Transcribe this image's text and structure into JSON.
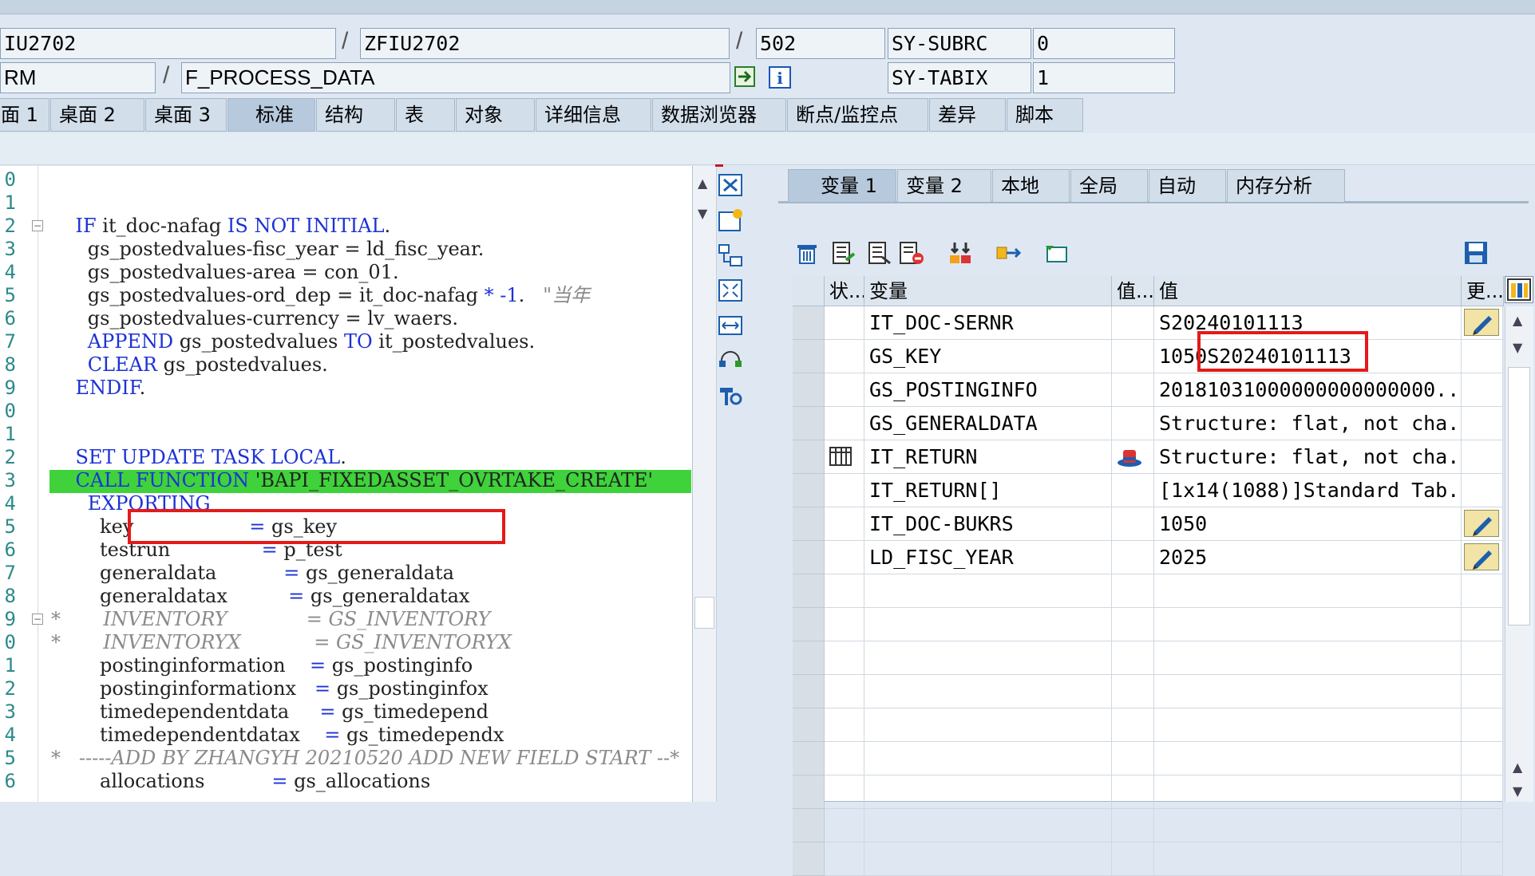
{
  "header": {
    "row1": {
      "program": "IU2702",
      "include": "ZFIU2702",
      "line": "502",
      "sysvar1_name": "SY-SUBRC",
      "sysvar1_value": "0"
    },
    "row2": {
      "event_type": "RM",
      "event": "F_PROCESS_DATA",
      "sysvar2_name": "SY-TABIX",
      "sysvar2_value": "1"
    },
    "separator": "/"
  },
  "tabs": [
    "面 1",
    "桌面 2",
    "桌面 3",
    "标准",
    "结构",
    "表",
    "对象",
    "详细信息",
    "数据浏览器",
    "断点/监控点",
    "差异",
    "脚本"
  ],
  "code": {
    "line_numbers": [
      "0",
      "1",
      "2",
      "3",
      "4",
      "5",
      "6",
      "7",
      "8",
      "9",
      "0",
      "1",
      "2",
      "3",
      "4",
      "5",
      "6",
      "7",
      "8",
      "9",
      "0",
      "1",
      "2",
      "3",
      "4",
      "5",
      "6"
    ],
    "lines": [
      [],
      [],
      [
        {
          "t": "    ",
          "c": "id"
        },
        {
          "t": "IF",
          "c": "kw"
        },
        {
          "t": " it_doc-nafag ",
          "c": "id"
        },
        {
          "t": "IS NOT INITIAL",
          "c": "kw"
        },
        {
          "t": ".",
          "c": "id"
        }
      ],
      [
        {
          "t": "      gs_postedvalues-fisc_year = ld_fisc_year.",
          "c": "id"
        }
      ],
      [
        {
          "t": "      gs_postedvalues-area = con_01.",
          "c": "id"
        }
      ],
      [
        {
          "t": "      gs_postedvalues-ord_dep = it_doc-nafag ",
          "c": "id"
        },
        {
          "t": "* -1",
          "c": "kw"
        },
        {
          "t": ".   ",
          "c": "id"
        },
        {
          "t": "\"当年",
          "c": "cm"
        }
      ],
      [
        {
          "t": "      gs_postedvalues-currency = lv_waers.",
          "c": "id"
        }
      ],
      [
        {
          "t": "      ",
          "c": "id"
        },
        {
          "t": "APPEND",
          "c": "kw"
        },
        {
          "t": " gs_postedvalues ",
          "c": "id"
        },
        {
          "t": "TO",
          "c": "kw"
        },
        {
          "t": " it_postedvalues.",
          "c": "id"
        }
      ],
      [
        {
          "t": "      ",
          "c": "id"
        },
        {
          "t": "CLEAR",
          "c": "kw"
        },
        {
          "t": " gs_postedvalues.",
          "c": "id"
        }
      ],
      [
        {
          "t": "    ",
          "c": "id"
        },
        {
          "t": "ENDIF",
          "c": "kw"
        },
        {
          "t": ".",
          "c": "id"
        }
      ],
      [],
      [],
      [
        {
          "t": "    ",
          "c": "id"
        },
        {
          "t": "SET UPDATE TASK LOCAL",
          "c": "kw"
        },
        {
          "t": ".",
          "c": "id"
        }
      ],
      [
        {
          "t": "    ",
          "c": "id"
        },
        {
          "t": "CALL FUNCTION",
          "c": "kw"
        },
        {
          "t": " 'BAPI_FIXEDASSET_OVRTAKE_CREATE'",
          "c": "id"
        }
      ],
      [
        {
          "t": "      ",
          "c": "id"
        },
        {
          "t": "EXPORTING",
          "c": "kw"
        }
      ],
      [
        {
          "t": "        key                   ",
          "c": "id"
        },
        {
          "t": "=",
          "c": "kw"
        },
        {
          "t": " gs_key",
          "c": "id"
        }
      ],
      [
        {
          "t": "        testrun               ",
          "c": "id"
        },
        {
          "t": "=",
          "c": "kw"
        },
        {
          "t": " p_test",
          "c": "id"
        }
      ],
      [
        {
          "t": "        generaldata           ",
          "c": "id"
        },
        {
          "t": "=",
          "c": "kw"
        },
        {
          "t": " gs_generaldata",
          "c": "id"
        }
      ],
      [
        {
          "t": "        generaldatax          ",
          "c": "id"
        },
        {
          "t": "=",
          "c": "kw"
        },
        {
          "t": " gs_generaldatax",
          "c": "id"
        }
      ],
      [
        {
          "t": "*       INVENTORY             = GS_INVENTORY",
          "c": "cm"
        }
      ],
      [
        {
          "t": "*       INVENTORYX            = GS_INVENTORYX",
          "c": "cm"
        }
      ],
      [
        {
          "t": "        postinginformation    ",
          "c": "id"
        },
        {
          "t": "=",
          "c": "kw"
        },
        {
          "t": " gs_postinginfo",
          "c": "id"
        }
      ],
      [
        {
          "t": "        postinginformationx   ",
          "c": "id"
        },
        {
          "t": "=",
          "c": "kw"
        },
        {
          "t": " gs_postinginfox",
          "c": "id"
        }
      ],
      [
        {
          "t": "        timedependentdata     ",
          "c": "id"
        },
        {
          "t": "=",
          "c": "kw"
        },
        {
          "t": " gs_timedepend",
          "c": "id"
        }
      ],
      [
        {
          "t": "        timedependentdatax    ",
          "c": "id"
        },
        {
          "t": "=",
          "c": "kw"
        },
        {
          "t": " gs_timedependx",
          "c": "id"
        }
      ],
      [
        {
          "t": "*   -----ADD BY ZHANGYH 20210520 ADD NEW FIELD START --*",
          "c": "cm"
        }
      ],
      [
        {
          "t": "        allocations           ",
          "c": "id"
        },
        {
          "t": "=",
          "c": "kw"
        },
        {
          "t": " gs_allocations",
          "c": "id"
        }
      ]
    ]
  },
  "var_tabs": [
    "变量 1",
    "变量 2",
    "本地",
    "全局",
    "自动",
    "内存分析"
  ],
  "grid": {
    "headers": {
      "status": "状...",
      "variable": "变量",
      "value_short": "值...",
      "value": "值",
      "change": "更..."
    },
    "rows": [
      {
        "var": "IT_DOC-SERNR",
        "val": " S20240101113",
        "edit": true
      },
      {
        "var": "GS_KEY",
        "val": "1050S20240101113",
        "edit": false
      },
      {
        "var": "GS_POSTINGINFO",
        "val": "20181031000000000000000...",
        "edit": false
      },
      {
        "var": "GS_GENERALDATA",
        "val": "Structure: flat, not cha...",
        "edit": false
      },
      {
        "var": "IT_RETURN",
        "val": "Structure: flat, not cha...",
        "edit": false
      },
      {
        "var": "IT_RETURN[]",
        "val": "[1x14(1088)]Standard Tab...",
        "edit": false
      },
      {
        "var": "IT_DOC-BUKRS",
        "val": "1050",
        "edit": true
      },
      {
        "var": "LD_FISC_YEAR",
        "val": "2025",
        "edit": true
      }
    ]
  },
  "colors": {
    "accent_highlight": "#3fd23b",
    "keyword": "#1c32d6",
    "annotation_box": "#e41a1a"
  }
}
